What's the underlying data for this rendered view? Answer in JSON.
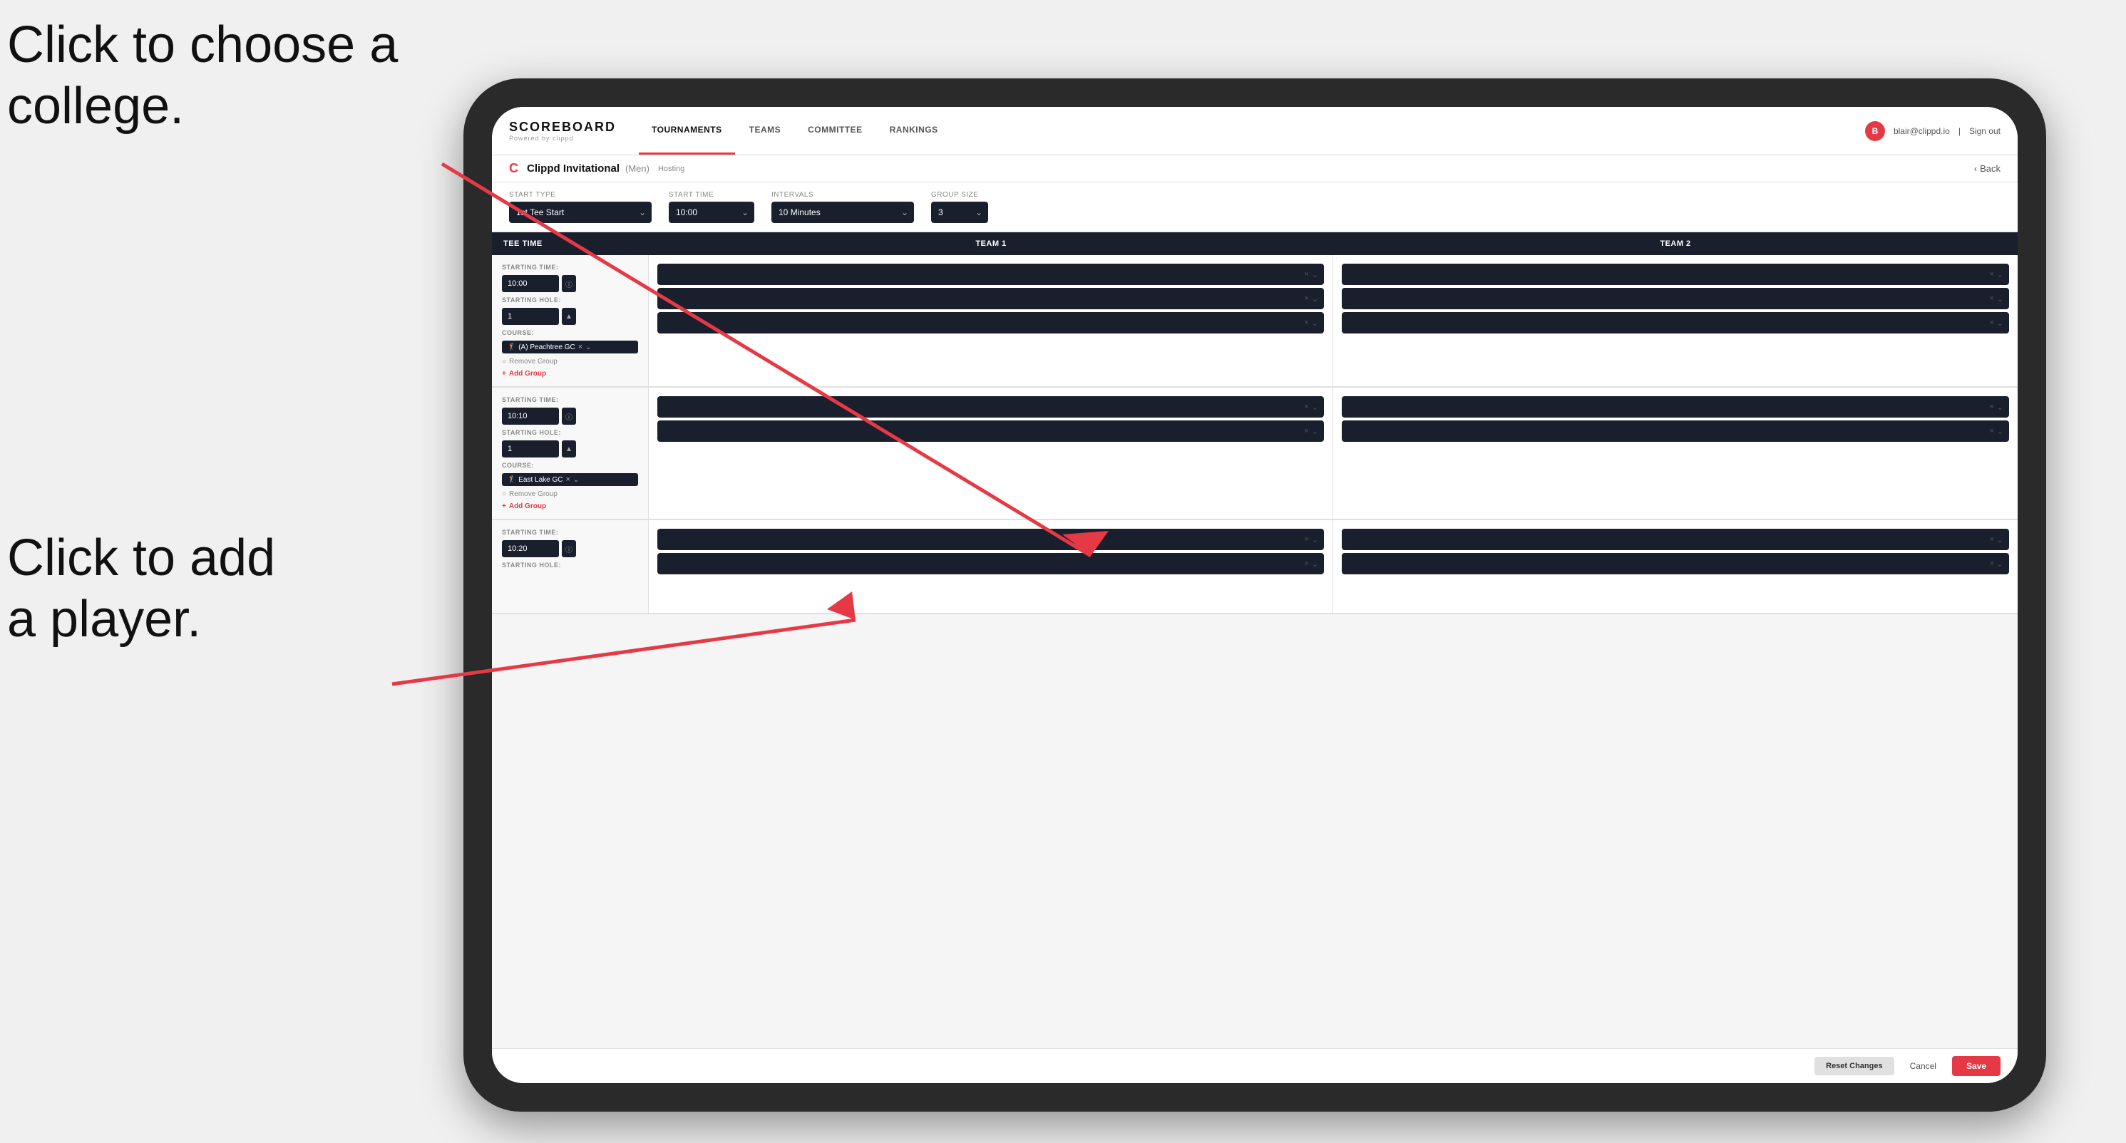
{
  "annotation": {
    "top_line1": "Click to choose a",
    "top_line2": "college.",
    "mid_line1": "Click to add",
    "mid_line2": "a player."
  },
  "header": {
    "logo": "SCOREBOARD",
    "logo_sub": "Powered by clippd",
    "nav": [
      "TOURNAMENTS",
      "TEAMS",
      "COMMITTEE",
      "RANKINGS"
    ],
    "active_tab": "TOURNAMENTS",
    "user_email": "blair@clippd.io",
    "sign_out": "Sign out",
    "back": "Back"
  },
  "sub_header": {
    "tournament": "Clippd Invitational",
    "gender": "(Men)",
    "hosting": "Hosting"
  },
  "form": {
    "start_type_label": "Start Type",
    "start_type_value": "1st Tee Start",
    "start_time_label": "Start Time",
    "start_time_value": "10:00",
    "intervals_label": "Intervals",
    "intervals_value": "10 Minutes",
    "group_size_label": "Group Size",
    "group_size_value": "3"
  },
  "table": {
    "col_tee": "Tee Time",
    "col_team1": "Team 1",
    "col_team2": "Team 2"
  },
  "rows": [
    {
      "starting_time": "10:00",
      "starting_hole": "1",
      "course": "(A) Peachtree GC",
      "remove_group": "Remove Group",
      "add_group": "Add Group",
      "team1_slots": 2,
      "team2_slots": 2,
      "has_course_row": true
    },
    {
      "starting_time": "10:10",
      "starting_hole": "1",
      "course": "East Lake GC",
      "remove_group": "Remove Group",
      "add_group": "Add Group",
      "team1_slots": 2,
      "team2_slots": 2,
      "has_course_row": true
    },
    {
      "starting_time": "10:20",
      "starting_hole": "",
      "course": "",
      "remove_group": "",
      "add_group": "",
      "team1_slots": 2,
      "team2_slots": 2,
      "has_course_row": false
    }
  ],
  "buttons": {
    "reset": "Reset Changes",
    "cancel": "Cancel",
    "save": "Save"
  }
}
